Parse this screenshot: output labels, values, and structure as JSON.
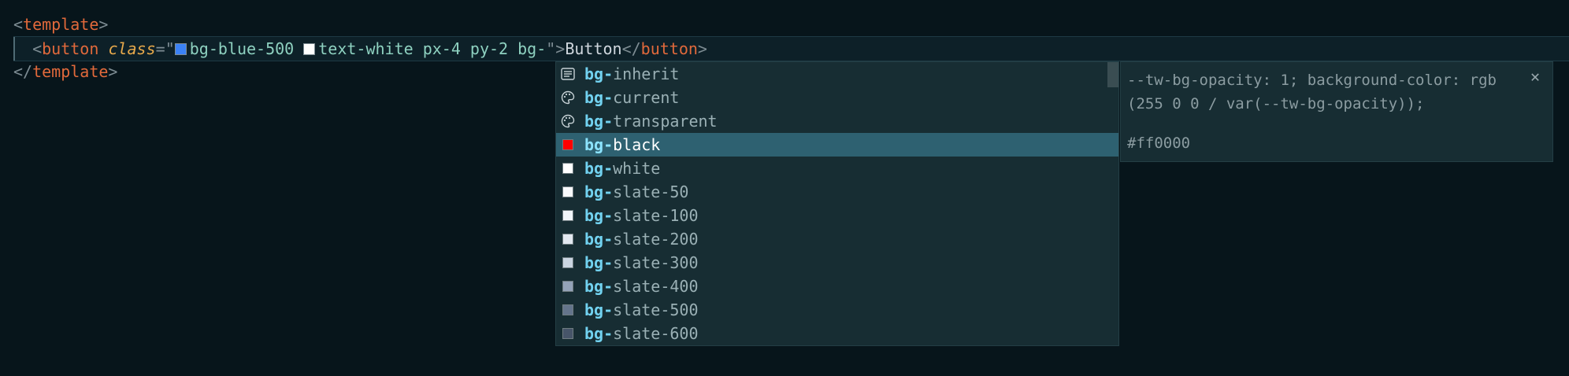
{
  "editor": {
    "line1": {
      "open_bracket": "<",
      "tag": "template",
      "close_bracket": ">"
    },
    "line2": {
      "indent": "  ",
      "open_bracket": "<",
      "tag": "button",
      "attr": "class",
      "equals_quote": "=\"",
      "class_1": "bg-blue-500",
      "class_1_color": "#3b82f6",
      "class_2": "text-white px-4 py-2 bg-",
      "class_2_color": "#ffffff",
      "close_quote": "\"",
      "gt": ">",
      "content": "Button",
      "close_open": "</",
      "close_tag": "button",
      "close_gt": ">"
    },
    "line3": {
      "open_bracket": "</",
      "tag": "template",
      "close_bracket": ">"
    }
  },
  "suggest": {
    "items": [
      {
        "prefix": "bg-",
        "rest": "inherit",
        "icon": "list-icon",
        "color": null
      },
      {
        "prefix": "bg-",
        "rest": "current",
        "icon": "palette-icon",
        "color": null
      },
      {
        "prefix": "bg-",
        "rest": "transparent",
        "icon": "palette-icon",
        "color": null
      },
      {
        "prefix": "bg-",
        "rest": "black",
        "icon": "color-swatch-icon",
        "color": "#ff0000",
        "selected": true
      },
      {
        "prefix": "bg-",
        "rest": "white",
        "icon": "color-swatch-icon",
        "color": "#ffffff"
      },
      {
        "prefix": "bg-",
        "rest": "slate-50",
        "icon": "color-swatch-icon",
        "color": "#f8fafc"
      },
      {
        "prefix": "bg-",
        "rest": "slate-100",
        "icon": "color-swatch-icon",
        "color": "#f1f5f9"
      },
      {
        "prefix": "bg-",
        "rest": "slate-200",
        "icon": "color-swatch-icon",
        "color": "#e2e8f0"
      },
      {
        "prefix": "bg-",
        "rest": "slate-300",
        "icon": "color-swatch-icon",
        "color": "#cbd5e1"
      },
      {
        "prefix": "bg-",
        "rest": "slate-400",
        "icon": "color-swatch-icon",
        "color": "#94a3b8"
      },
      {
        "prefix": "bg-",
        "rest": "slate-500",
        "icon": "color-swatch-icon",
        "color": "#64748b"
      },
      {
        "prefix": "bg-",
        "rest": "slate-600",
        "icon": "color-swatch-icon",
        "color": "#475569"
      }
    ]
  },
  "details": {
    "declaration": "--tw-bg-opacity: 1; background-color: rgb (255 0 0 / var(--tw-bg-opacity));",
    "hex": "#ff0000",
    "close_icon": "close-icon"
  },
  "colors": {
    "background": "#07151b",
    "tag": "#e1693b",
    "attribute": "#e8a94b",
    "string": "#8ed1c0",
    "selection": "#2e6171"
  }
}
